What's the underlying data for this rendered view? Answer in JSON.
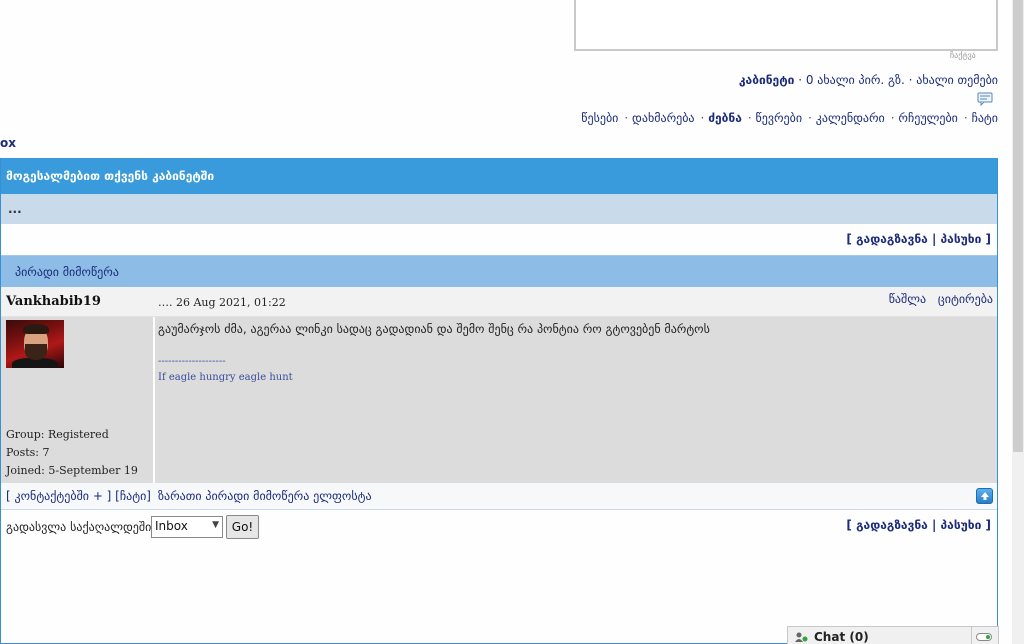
{
  "top_editor": {
    "caption": "ჩაქტვა"
  },
  "user_line": {
    "cabinet": "კაბინეტი",
    "rest": " · 0 ახალი პირ. გზ. · ახალი თემები"
  },
  "nav": {
    "items": [
      {
        "label": "წესები",
        "active": false
      },
      {
        "label": "დახმარება",
        "active": false
      },
      {
        "label": "ძებნა",
        "active": true
      },
      {
        "label": "წევრები",
        "active": false
      },
      {
        "label": "კალენდარი",
        "active": false
      },
      {
        "label": "რჩეულები",
        "active": false
      },
      {
        "label": "ჩატი",
        "active": false
      }
    ]
  },
  "breadcrumb": "ox",
  "main": {
    "welcome": "მოგესალმებით თქვენს კაბინეტში",
    "sub": "...",
    "actions": "[ გადაგზავნა | პასუხი ]",
    "section_title": "პირადი მიმოწერა"
  },
  "post": {
    "author": "Vankhabib19",
    "date": "…. 26 Aug 2021, 01:22",
    "tools": [
      "წაშლა",
      "ციტირება"
    ],
    "message": "გაუმარჯოს ძმა, აგერაა ლინკი სადაც გადადიან და შემო შენც რა პონტია რო გტოვებენ მარტოს",
    "sig_divider": "--------------------",
    "signature": "If eagle hungry eagle hunt",
    "group": "Group: Registered",
    "posts": "Posts: 7",
    "joined": "Joined: 5-September 19",
    "foot_left": "[ კონტაქტებში + ] [ჩატი]",
    "foot_mid": "ზარათი პირადი მიმოწერა ელფოსტა"
  },
  "jump": {
    "label": "გადასვლა საქაღალდეში:",
    "selected": "Inbox",
    "go": "Go!",
    "actions": "[ გადაგზავნა | პასუხი ]"
  },
  "chat": {
    "label": "Chat (0)"
  },
  "colors": {
    "header_blue": "#3a9bdc",
    "section_blue": "#8dbde6",
    "link": "#1b2b7a",
    "post_bg": "#dcdcdc"
  }
}
